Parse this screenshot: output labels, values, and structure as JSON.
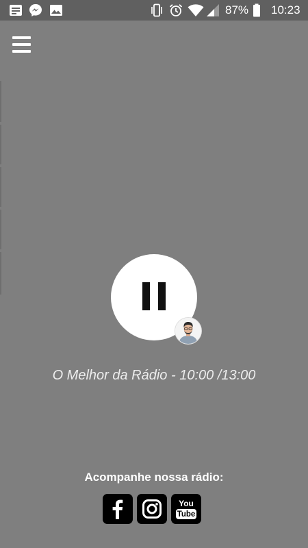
{
  "status_bar": {
    "battery": "87%",
    "time": "10:23",
    "icons": [
      "notes-icon",
      "messenger-icon",
      "image-icon",
      "vibrate-icon",
      "alarm-icon",
      "wifi-icon",
      "signal-icon",
      "battery-icon"
    ]
  },
  "header": {
    "menu_icon": "hamburger-menu-icon"
  },
  "player": {
    "state": "playing",
    "control_icon": "pause-icon",
    "program": "O Melhor da Rádio - 10:00 /13:00"
  },
  "social": {
    "heading": "Acompanhe nossa rádio:",
    "links": [
      {
        "icon": "facebook-icon"
      },
      {
        "icon": "instagram-icon"
      },
      {
        "icon": "youtube-icon",
        "text_top": "You",
        "text_bottom": "Tube"
      }
    ]
  },
  "colors": {
    "background": "#7f7f7f",
    "status_bar": "#606060",
    "button": "#ffffff",
    "social_bg": "#000000"
  }
}
